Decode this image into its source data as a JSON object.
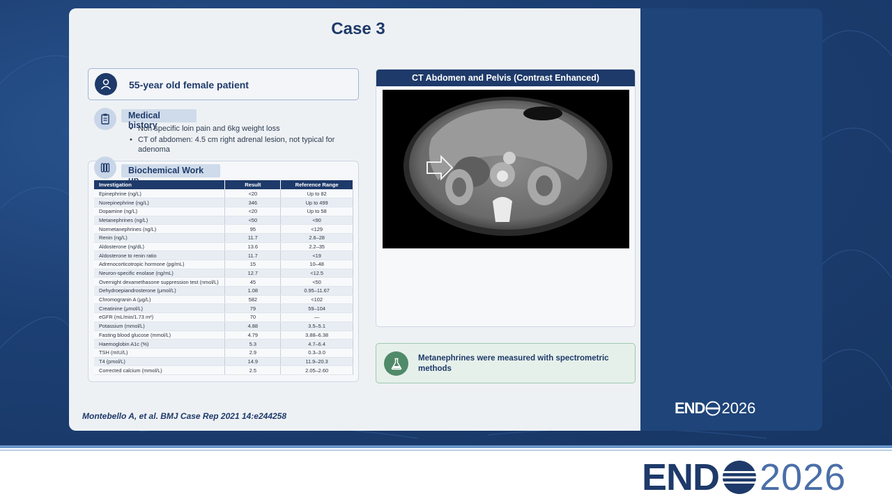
{
  "slide": {
    "title": "Case 3",
    "patient": "55-year old female patient",
    "history_label": "Medical history",
    "history_items": [
      "Non specific loin pain and 6kg weight loss",
      "CT of abdomen: 4.5 cm right adrenal lesion, not typical for adenoma"
    ],
    "biochem_label": "Biochemical Work up",
    "table": {
      "headers": [
        "Investigation",
        "Result",
        "Reference Range"
      ],
      "rows": [
        [
          "Epinephrine (ng/L)",
          "<20",
          "Up to 82"
        ],
        [
          "Norepinephrine (ng/L)",
          "346",
          "Up to 499"
        ],
        [
          "Dopamine (ng/L)",
          "<20",
          "Up to 58"
        ],
        [
          "Metanephrines (ng/L)",
          "<50",
          "<90"
        ],
        [
          "Normetanephrines (ng/L)",
          "95",
          "<129"
        ],
        [
          "Renin (ng/L)",
          "11.7",
          "2.6–28"
        ],
        [
          "Aldosterone (ng/dL)",
          "13.6",
          "2.2–35"
        ],
        [
          "Aldosterone to renin ratio",
          "11.7",
          "<19"
        ],
        [
          "Adrenocorticotropic hormone (pg/mL)",
          "15",
          "10–48"
        ],
        [
          "Neuron-specific enolase (ng/mL)",
          "12.7",
          "<12.5"
        ],
        [
          "Overnight dexamethasone suppression test (nmol/L)",
          "45",
          "<50"
        ],
        [
          "Dehydroepiandrosterone (μmol/L)",
          "1.08",
          "0.95–11.67"
        ],
        [
          "Chromogranin A (μg/L)",
          "582",
          "<102"
        ],
        [
          "Creatinine (μmol/L)",
          "79",
          "59–104"
        ],
        [
          "eGFR (mL/min/1.73 m²)",
          "70",
          "—"
        ],
        [
          "Potassium (mmol/L)",
          "4.88",
          "3.5–5.1"
        ],
        [
          "Fasting blood glucose (mmol/L)",
          "4.79",
          "3.88–6.38"
        ],
        [
          "Haemoglobin A1c (%)",
          "5.3",
          "4.7–6.4"
        ],
        [
          "TSH (mIU/L)",
          "2.9",
          "0.3–3.0"
        ],
        [
          "T4 (pmol/L)",
          "14.9",
          "11.9–20.3"
        ],
        [
          "Corrected calcium (mmol/L)",
          "2.5",
          "2.05–2.60"
        ]
      ]
    },
    "ct_header": "CT Abdomen and Pelvis (Contrast Enhanced)",
    "note": "Metanephrines were measured with spectrometric methods",
    "citation": "Montebello A, et al. BMJ Case Rep 2021 14:e244258"
  },
  "logo": {
    "bold": "END",
    "year": "2026"
  },
  "colors": {
    "navy": "#1e3a6a",
    "green": "#4f8a69",
    "background": "#1c3f73"
  }
}
